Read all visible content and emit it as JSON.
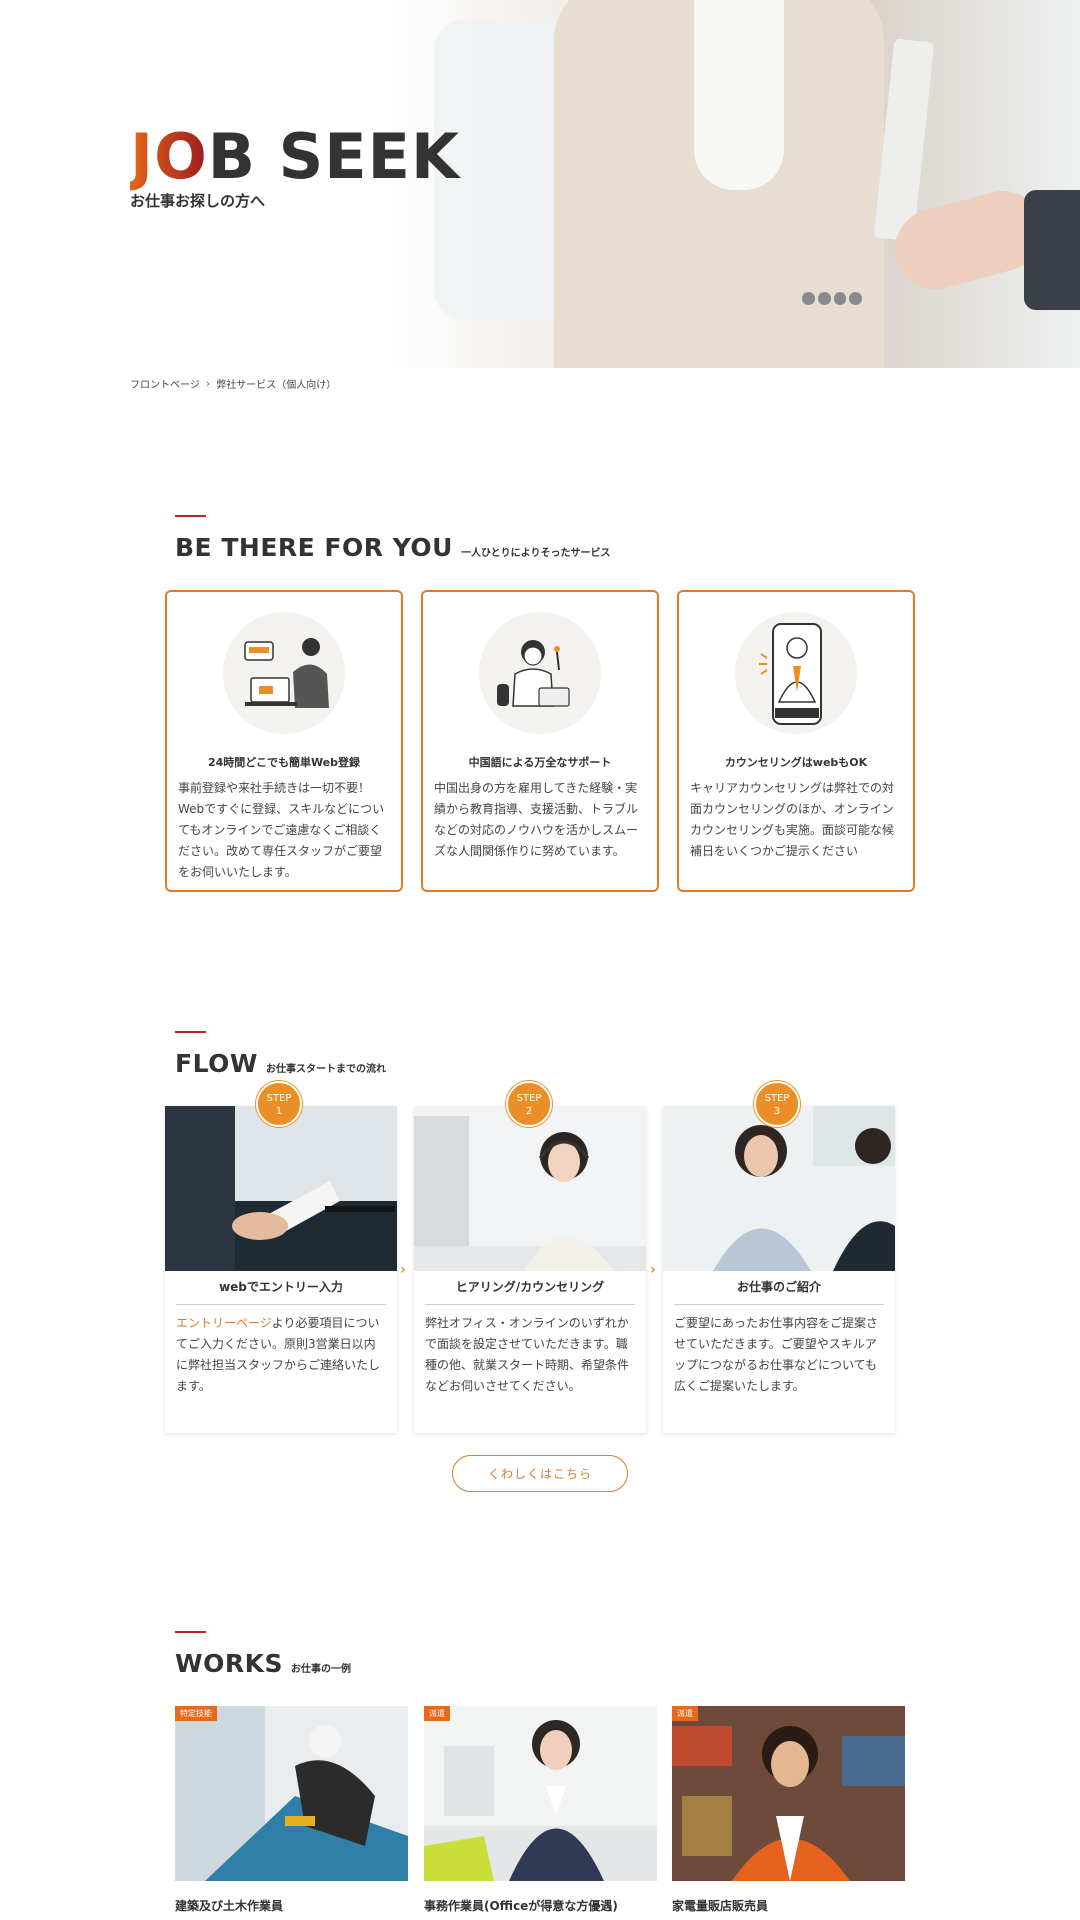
{
  "hero": {
    "title_accent": "JO",
    "title_rest": "B SEEK",
    "subtitle": "お仕事お探しの方へ"
  },
  "breadcrumb": {
    "home": "フロントページ",
    "separator": "›",
    "current": "弊社サービス（個人向け）"
  },
  "about": {
    "title": "BE THERE FOR YOU",
    "subtitle": "一人ひとりによりそったサービス",
    "cards": [
      {
        "title": "24時間どこでも簡単Web登録",
        "body": "事前登録や来社手続きは一切不要！Webですぐに登録、スキルなどについてもオンラインでご遠慮なくご相談ください。改めて専任スタッフがご要望をお伺いいたします。"
      },
      {
        "title": "中国語による万全なサポート",
        "body": "中国出身の方を雇用してきた経験・実績から教育指導、支援活動、トラブルなどの対応のノウハウを活かしスムーズな人間関係作りに努めています。"
      },
      {
        "title": "カウンセリングはwebもOK",
        "body": "キャリアカウンセリングは弊社での対面カウンセリングのほか、オンラインカウンセリングも実施。面談可能な候補日をいくつかご提示ください"
      }
    ]
  },
  "flow": {
    "title": "FLOW",
    "subtitle": "お仕事スタートまでの流れ",
    "steps": [
      {
        "badge_label": "STEP",
        "badge_num": "1",
        "title": "webでエントリー入力",
        "link": "エントリーページ",
        "body": "より必要項目についてご入力ください。原則3営業日以内に弊社担当スタッフからご連絡いたします。"
      },
      {
        "badge_label": "STEP",
        "badge_num": "2",
        "title": "ヒアリング/カウンセリング",
        "body": "弊社オフィス・オンラインのいずれかで面談を設定させていただきます。職種の他、就業スタート時期、希望条件などお伺いさせてください。"
      },
      {
        "badge_label": "STEP",
        "badge_num": "3",
        "title": "お仕事のご紹介",
        "body": "ご要望にあったお仕事内容をご提案させていただきます。ご要望やスキルアップにつながるお仕事などについても広くご提案いたします。"
      }
    ],
    "more_button": "くわしくはこちら"
  },
  "works": {
    "title": "WORKS",
    "subtitle": "お仕事の一例",
    "items": [
      {
        "tag": "特定技能",
        "title": "建築及び土木作業員"
      },
      {
        "tag": "派遣",
        "title": "事務作業員(Officeが得意な方優遇)"
      },
      {
        "tag": "派遣",
        "title": "家電量販店販売員"
      }
    ]
  },
  "colors": {
    "accent": "#e07a2a",
    "badge": "#e98f25",
    "section_bar": "#b02a2a",
    "tag": "#e9681c"
  }
}
